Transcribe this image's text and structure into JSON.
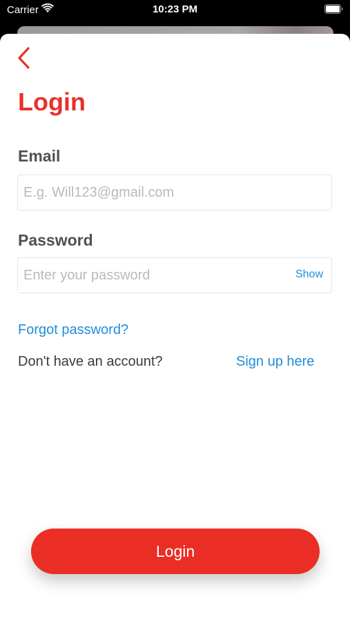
{
  "status_bar": {
    "carrier": "Carrier",
    "time": "10:23 PM",
    "wifi_icon": "wifi-icon",
    "battery_icon": "battery-icon"
  },
  "nav": {
    "back_icon": "chevron-left-icon",
    "back_color": "#e8312a"
  },
  "login": {
    "title": "Login",
    "email_label": "Email",
    "email_placeholder": "E.g. Will123@gmail.com",
    "email_value": "",
    "password_label": "Password",
    "password_placeholder": "Enter your password",
    "password_value": "",
    "show_label": "Show",
    "forgot_label": "Forgot password?",
    "no_account_text": "Don't have an account?",
    "signup_label": "Sign up here",
    "submit_label": "Login"
  },
  "colors": {
    "accent_red": "#ea2e25",
    "link_blue": "#1f8ddb",
    "label_gray": "#505050"
  }
}
